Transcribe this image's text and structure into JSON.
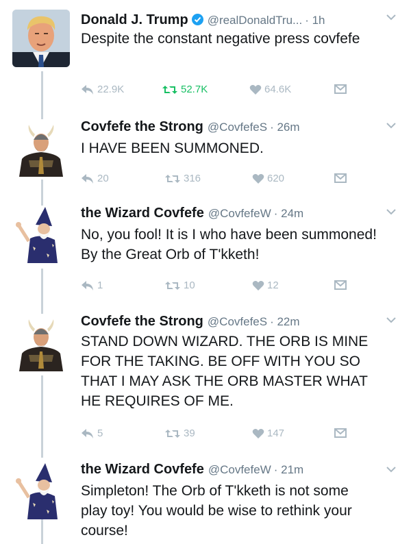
{
  "tweets": [
    {
      "name": "Donald J. Trump",
      "verified": true,
      "handle": "@realDonaldTru...",
      "time": "· 1h",
      "text": "Despite the constant negative press covfefe",
      "replies": "22.9K",
      "retweets": "52.7K",
      "likes": "64.6K",
      "retweet_active": true
    },
    {
      "name": "Covfefe the Strong",
      "handle": "@CovfefeS",
      "time": "· 26m",
      "text": "I HAVE BEEN SUMMONED.",
      "replies": "20",
      "retweets": "316",
      "likes": "620"
    },
    {
      "name": "the Wizard Covfefe",
      "handle": "@CovfefeW",
      "time": "· 24m",
      "text": "No, you fool! It is I who have been summoned! By the Great Orb of T'kketh!",
      "replies": "1",
      "retweets": "10",
      "likes": "12"
    },
    {
      "name": "Covfefe the Strong",
      "handle": "@CovfefeS",
      "time": "· 22m",
      "text": "STAND DOWN WIZARD. THE ORB IS MINE FOR THE TAKING. BE OFF WITH YOU SO THAT I MAY ASK THE ORB MASTER WHAT HE REQUIRES OF ME.",
      "replies": "5",
      "retweets": "39",
      "likes": "147"
    },
    {
      "name": "the Wizard Covfefe",
      "handle": "@CovfefeW",
      "time": "· 21m",
      "text": "Simpleton! The Orb of T'kketh is not some play toy! You would be wise to rethink your course!"
    }
  ],
  "colors": {
    "text": "#14171a",
    "muted": "#657786",
    "action_gray": "#aab8c2",
    "retweet_green": "#17bf63",
    "verified_blue": "#1da1f2"
  },
  "icons": [
    "verified-badge-icon",
    "chevron-down-icon",
    "reply-icon",
    "retweet-icon",
    "like-heart-icon",
    "direct-message-icon"
  ]
}
